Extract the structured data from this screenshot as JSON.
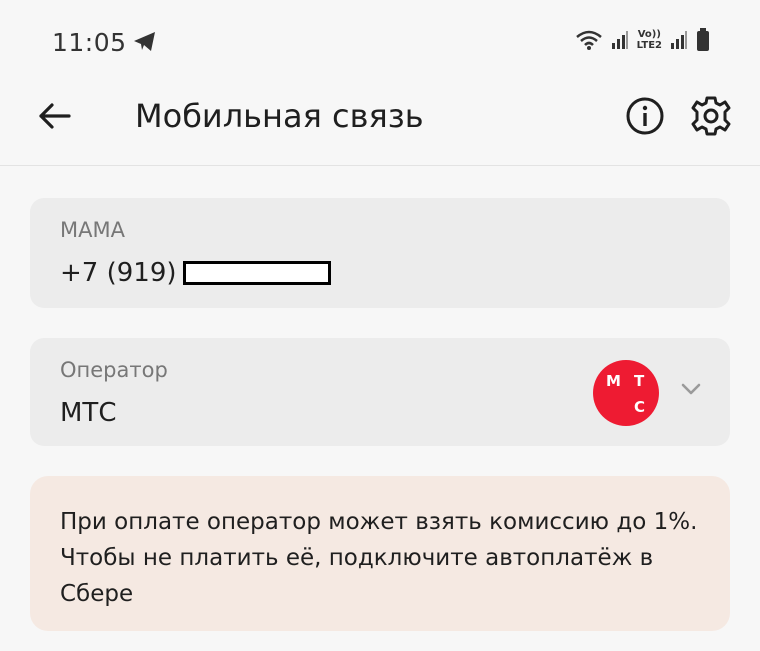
{
  "status_bar": {
    "time": "11:05",
    "icons": [
      "telegram-icon",
      "wifi-icon",
      "signal-icon",
      "volte-icon",
      "signal-icon-2",
      "battery-icon"
    ],
    "volte_label": "Vo))",
    "lte_label": "LTE2"
  },
  "app_bar": {
    "title": "Мобильная связь",
    "back_icon": "arrow-left-icon",
    "info_icon": "info-icon",
    "settings_icon": "gear-icon"
  },
  "contact": {
    "label": "МАМА",
    "phone_prefix": "+7 (919)"
  },
  "operator": {
    "label": "Оператор",
    "value": "МТС",
    "logo": {
      "letters": [
        "М",
        "Т",
        "С"
      ],
      "color": "#ee1b32"
    }
  },
  "notice": {
    "text": "При оплате оператор может взять комиссию до 1%. Чтобы не платить её, подключите автоплатёж в Сбере"
  },
  "colors": {
    "background": "#f7f7f7",
    "card": "#ececec",
    "notice_bg": "#f5e9e2",
    "mts_red": "#ee1b32"
  }
}
